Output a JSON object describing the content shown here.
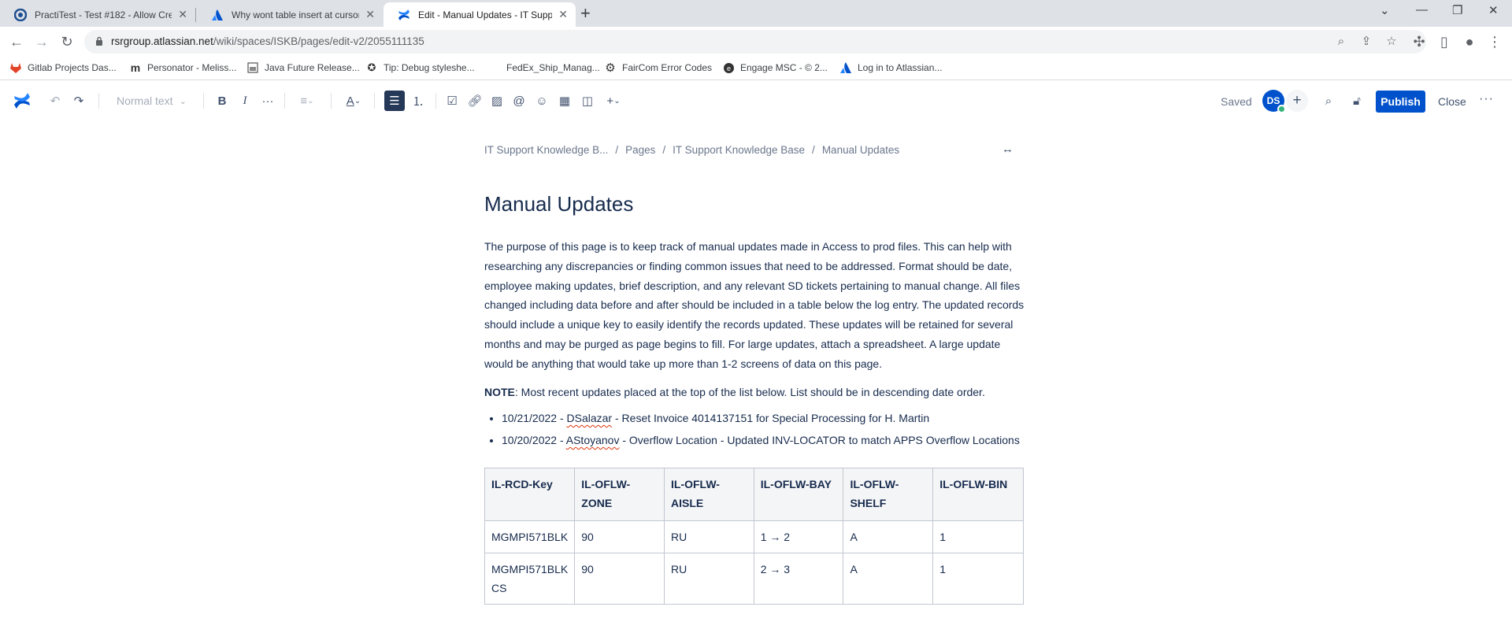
{
  "browser": {
    "tabs": [
      {
        "title": "PractiTest - Test #182 - Allow Cre"
      },
      {
        "title": "Why wont table insert at cursor p"
      },
      {
        "title": "Edit - Manual Updates - IT Suppo"
      }
    ],
    "url_host": "rsrgroup.atlassian.net",
    "url_path": "/wiki/spaces/ISKB/pages/edit-v2/2055111135",
    "bookmarks": [
      {
        "label": "Gitlab Projects Das..."
      },
      {
        "label": "Personator - Meliss..."
      },
      {
        "label": "Java Future Release..."
      },
      {
        "label": "Tip: Debug styleshe..."
      },
      {
        "label": "FedEx_Ship_Manag..."
      },
      {
        "label": "FairCom Error Codes"
      },
      {
        "label": "Engage MSC - © 2..."
      },
      {
        "label": "Log in to Atlassian..."
      }
    ]
  },
  "toolbar": {
    "text_style": "Normal text",
    "saved_label": "Saved",
    "avatar_initials": "DS",
    "publish_label": "Publish",
    "close_label": "Close"
  },
  "page": {
    "breadcrumb": [
      "IT Support Knowledge B...",
      "Pages",
      "IT Support Knowledge Base",
      "Manual Updates"
    ],
    "title": "Manual Updates",
    "intro": "The purpose of this page is to keep track of manual updates made in Access to prod files. This can help with researching any discrepancies or finding common issues that need to be addressed. Format should be date, employee making updates, brief description, and any relevant SD tickets pertaining to manual change. All files changed including data before and after should be included in a table below the log entry. The updated records should include a unique key to easily identify the records updated. These updates will be retained for several months and may be purged as page begins to fill.  For large updates, attach a spreadsheet. A large update would be anything that would take up more than 1-2 screens of data on this page.",
    "note_label": "NOTE",
    "note_text": ": Most recent updates placed at the top of the list below.  List should be in descending date order.",
    "log_entries": [
      {
        "date": "10/21/2022 - ",
        "user": "DSalazar",
        "desc": " - Reset Invoice 4014137151 for Special Processing for H. Martin"
      },
      {
        "date": "10/20/2022 - ",
        "user": "AStoyanov",
        "desc": " - Overflow Location - Updated INV-LOCATOR to match APPS Overflow Locations"
      }
    ],
    "table": {
      "headers": [
        "IL-RCD-Key",
        "IL-OFLW-ZONE",
        "IL-OFLW-AISLE",
        "IL-OFLW-BAY",
        "IL-OFLW-SHELF",
        "IL-OFLW-BIN"
      ],
      "rows": [
        [
          "MGMPI571BLK",
          "90",
          "RU",
          "1 → 2",
          "A",
          "1"
        ],
        [
          "MGMPI571BLKCS",
          "90",
          "RU",
          "2 → 3",
          "A",
          "1"
        ]
      ]
    }
  },
  "colors": {
    "primary": "#0052cc",
    "text": "#172b4d",
    "subtle": "#6b778c",
    "toolbar_active": "#253858"
  }
}
